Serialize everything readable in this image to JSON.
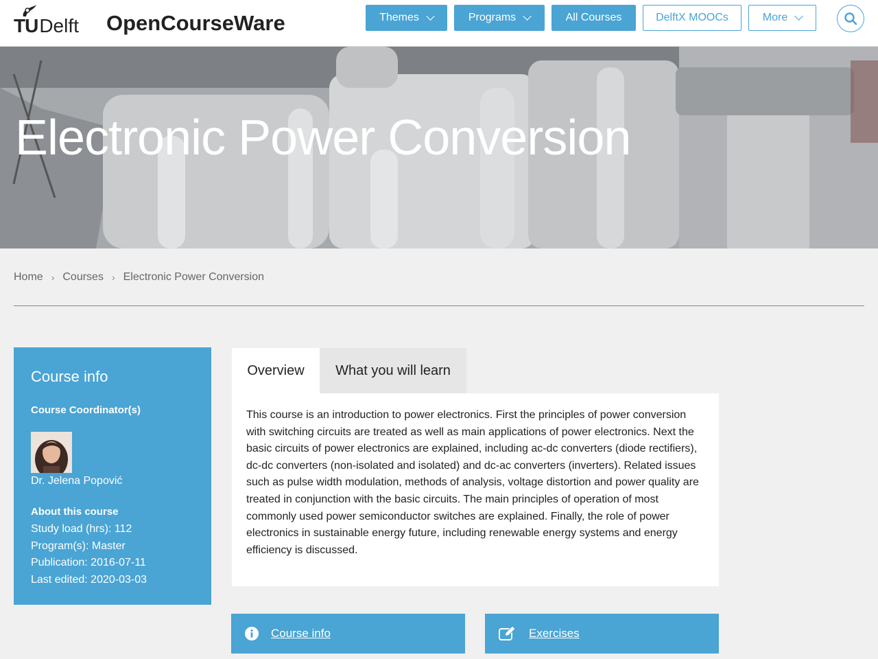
{
  "header": {
    "logo_tu": "TU",
    "logo_delft": "Delft",
    "site_title": "OpenCourseWare",
    "nav": {
      "themes": "Themes",
      "programs": "Programs",
      "all_courses": "All Courses",
      "delftx": "DelftX MOOCs",
      "more": "More"
    }
  },
  "hero": {
    "title": "Electronic Power Conversion"
  },
  "breadcrumb": {
    "home": "Home",
    "courses": "Courses",
    "current": "Electronic Power Conversion"
  },
  "sidebar": {
    "title": "Course info",
    "coordinator_label": "Course Coordinator(s)",
    "coordinator_name": "Dr. Jelena Popović",
    "about_label": "About this course",
    "study_load": "Study load (hrs): 112",
    "program": "Program(s): Master",
    "publication": "Publication: 2016-07-11",
    "last_edited": "Last edited: 2020-03-03"
  },
  "tabs": {
    "overview": "Overview",
    "learn": "What you will learn"
  },
  "overview_text": "This course is an introduction to power electronics. First the principles of power conversion with switching circuits are treated as well as main applications of power electronics. Next the basic circuits of power electronics are explained, including ac-dc converters (diode rectifiers), dc-dc converters (non-isolated and isolated) and dc-ac converters (inverters). Related issues such as pulse width modulation, methods of analysis, voltage distortion and power quality are treated in conjunction with the basic circuits. The main principles of operation of most commonly used power semiconductor switches are explained. Finally, the role of power electronics in sustainable energy future, including renewable energy systems and energy efficiency is discussed.",
  "bottom_buttons": {
    "course_info": "Course info",
    "exercises": "Exercises"
  },
  "colors": {
    "accent": "#4aa4d4",
    "background": "#f0f0f0"
  }
}
